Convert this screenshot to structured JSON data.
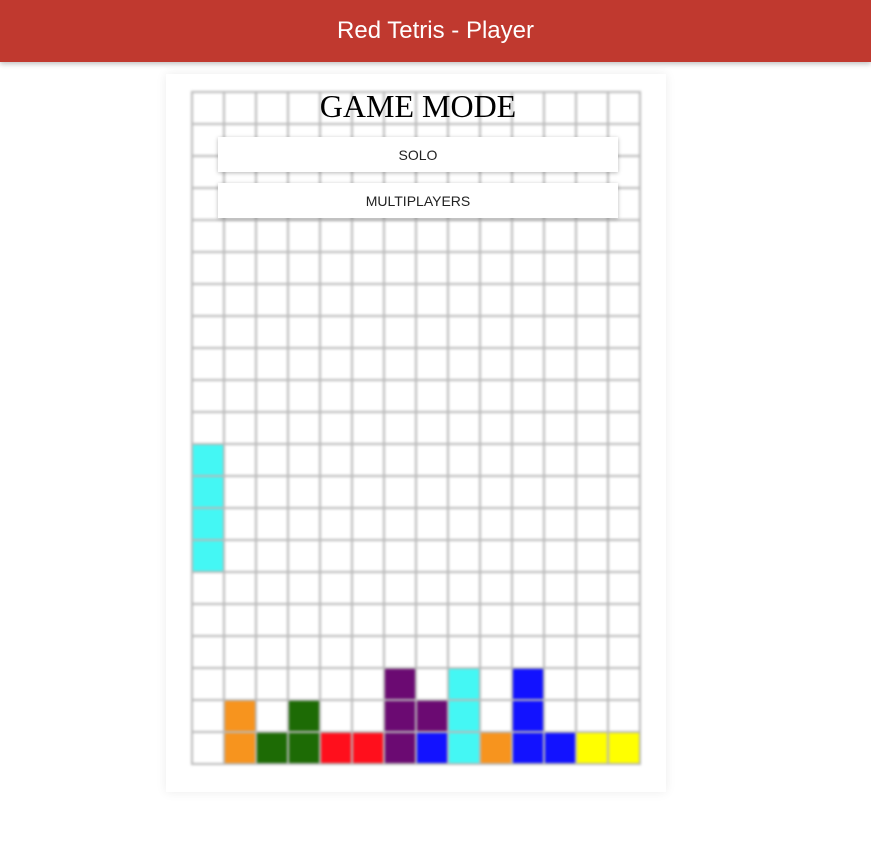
{
  "header": {
    "title": "Red Tetris - Player"
  },
  "menu": {
    "title": "GAME MODE",
    "solo_label": "SOLO",
    "multi_label": "MULTIPLAYERS"
  },
  "board": {
    "cols": 14,
    "rows": 21,
    "colors": {
      "I": "#44f7f4",
      "L": "#f7941e",
      "S": "#1d6b05",
      "Z": "#ff0f1c",
      "T": "#6b0a72",
      "J": "#1212ff",
      "O": "#ffff00"
    },
    "filled": [
      {
        "row": 11,
        "col": 0,
        "piece": "I"
      },
      {
        "row": 12,
        "col": 0,
        "piece": "I"
      },
      {
        "row": 13,
        "col": 0,
        "piece": "I"
      },
      {
        "row": 14,
        "col": 0,
        "piece": "I"
      },
      {
        "row": 18,
        "col": 6,
        "piece": "T"
      },
      {
        "row": 18,
        "col": 8,
        "piece": "I"
      },
      {
        "row": 18,
        "col": 10,
        "piece": "J"
      },
      {
        "row": 19,
        "col": 1,
        "piece": "L"
      },
      {
        "row": 19,
        "col": 3,
        "piece": "S"
      },
      {
        "row": 19,
        "col": 6,
        "piece": "T"
      },
      {
        "row": 19,
        "col": 7,
        "piece": "T"
      },
      {
        "row": 19,
        "col": 8,
        "piece": "I"
      },
      {
        "row": 19,
        "col": 10,
        "piece": "J"
      },
      {
        "row": 20,
        "col": 1,
        "piece": "L"
      },
      {
        "row": 20,
        "col": 2,
        "piece": "S"
      },
      {
        "row": 20,
        "col": 3,
        "piece": "S"
      },
      {
        "row": 20,
        "col": 4,
        "piece": "Z"
      },
      {
        "row": 20,
        "col": 5,
        "piece": "Z"
      },
      {
        "row": 20,
        "col": 6,
        "piece": "T"
      },
      {
        "row": 20,
        "col": 7,
        "piece": "J"
      },
      {
        "row": 20,
        "col": 8,
        "piece": "I"
      },
      {
        "row": 20,
        "col": 9,
        "piece": "L"
      },
      {
        "row": 20,
        "col": 10,
        "piece": "J"
      },
      {
        "row": 20,
        "col": 11,
        "piece": "J"
      },
      {
        "row": 20,
        "col": 12,
        "piece": "O"
      },
      {
        "row": 20,
        "col": 13,
        "piece": "O"
      }
    ]
  }
}
